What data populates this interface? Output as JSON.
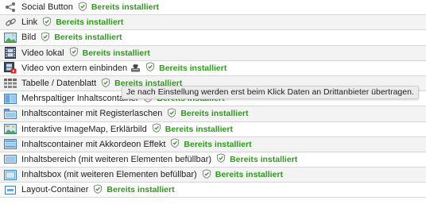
{
  "status_text": "Bereits installiert",
  "status_color": "#2e9b1a",
  "rows": [
    {
      "label": "Social Button",
      "icon": "share-icon"
    },
    {
      "label": "Link",
      "icon": "link-icon"
    },
    {
      "label": "Bild",
      "icon": "image-icon"
    },
    {
      "label": "Video lokal",
      "icon": "film-icon"
    },
    {
      "label": "Video von extern einbinden",
      "icon": "external-video-icon"
    },
    {
      "label": "Tabelle / Datenblatt",
      "icon": "table-icon"
    },
    {
      "label": "Mehrspaltiger Inhaltscontainer",
      "icon": "columns-icon"
    },
    {
      "label": "Inhaltscontainer mit Registerlaschen",
      "icon": "tabs-container-icon"
    },
    {
      "label": "Interaktive ImageMap, Erklärbild",
      "icon": "imagemap-icon"
    },
    {
      "label": "Inhaltscontainer mit Akkordeon Effekt",
      "icon": "accordion-icon"
    },
    {
      "label": "Inhaltsbereich (mit weiteren Elementen befüllbar)",
      "icon": "content-area-icon"
    },
    {
      "label": "Inhaltsbox (mit weiteren Elementen befüllbar)",
      "icon": "content-box-icon"
    },
    {
      "label": "Layout-Container",
      "icon": "layout-container-icon"
    }
  ],
  "tooltip": "Je nach Einstellung werden erst beim Klick Daten an Drittanbieter übertragen."
}
